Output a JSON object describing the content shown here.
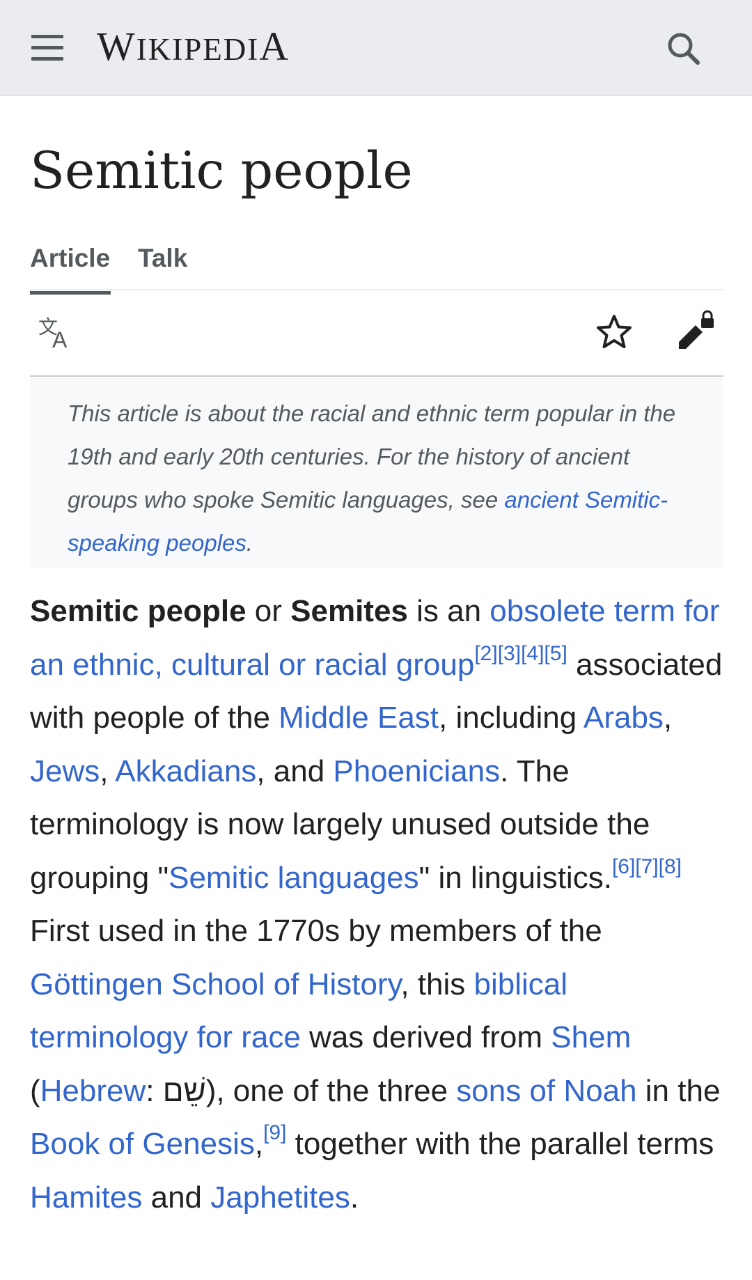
{
  "header": {
    "wordmark_w": "W",
    "wordmark_iki": "IKIPEDI",
    "wordmark_a": "A",
    "menu_icon": "hamburger-menu-icon",
    "search_icon": "search-icon"
  },
  "page": {
    "title": "Semitic people"
  },
  "tabs": [
    {
      "label": "Article",
      "selected": true
    },
    {
      "label": "Talk",
      "selected": false
    }
  ],
  "actions": {
    "language_icon": "language-icon",
    "watch_icon": "star-icon",
    "edit_icon": "edit-locked-icon"
  },
  "hatnote": {
    "text": "This article is about the racial and ethnic term popular in the 19th and early 20th centuries. For the history of ancient groups who spoke Semitic languages, see ",
    "link": "ancient Semitic-speaking peoples",
    "end": "."
  },
  "lead": {
    "b1": "Semitic people",
    "t1": " or ",
    "b2": "Semites",
    "t2": " is an ",
    "l1": "obsolete term for an ethnic, cultural or racial group",
    "r1": "[2]",
    "r2": "[3]",
    "r3": "[4]",
    "r4": "[5]",
    "t3": " associated with people of the ",
    "l2": "Middle East",
    "t4": ", including ",
    "l3": "Arabs",
    "t5": ", ",
    "l4": "Jews",
    "t6": ", ",
    "l5": "Akkadians",
    "t7": ", and ",
    "l6": "Phoenicians",
    "t8": ". The terminology is now largely unused outside the grouping \"",
    "l7": "Semitic languages",
    "t9": "\" in linguistics.",
    "r5": "[6]",
    "r6": "[7]",
    "r7": "[8]",
    "t10": " First used in the 1770s by members of the ",
    "l8": "Göttingen School of History",
    "t11": ", this ",
    "l9": "biblical terminology for race",
    "t12": " was derived from ",
    "l10": "Shem",
    "t13": " (",
    "l11": "Hebrew",
    "t14": ": ",
    "hebrew": "שֵׁם",
    "t15": "), one of the three ",
    "l12": "sons of Noah",
    "t16": " in the ",
    "l13": "Book of Genesis",
    "t17": ",",
    "r8": "[9]",
    "t18": " together with the parallel terms ",
    "l14": "Hamites",
    "t19": " and ",
    "l15": "Japhetites",
    "t20": "."
  },
  "colors": {
    "link": "#3366cc",
    "text": "#202122",
    "header_bg": "#eaecf0",
    "hatnote_bg": "#f8f9fa",
    "icon": "#54595d"
  }
}
